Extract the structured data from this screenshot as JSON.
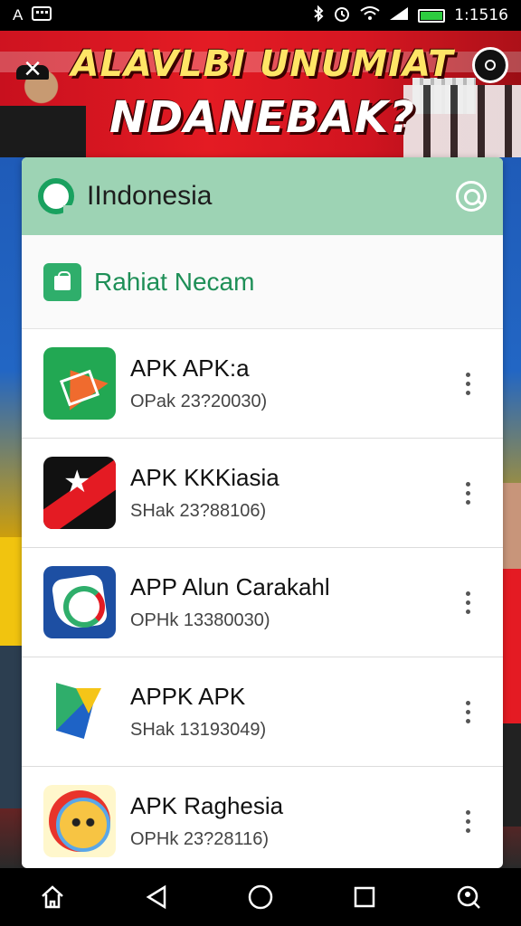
{
  "status_bar": {
    "left_icons": [
      "A",
      "notification-icon"
    ],
    "time": "1:1516"
  },
  "banner": {
    "line1": "ALAVLBI UNUMIAT",
    "line2": "NDANEBAK?",
    "close_label": "×"
  },
  "search": {
    "query": "IIndonesia"
  },
  "section": {
    "title": "Rahiat Necam"
  },
  "apps": [
    {
      "name": "APK APK:a",
      "meta": "OPak 23?20030)",
      "icon": "green-plane-icon"
    },
    {
      "name": "APK KKKiasia",
      "meta": "SHak 23?88106)",
      "icon": "red-star-icon"
    },
    {
      "name": "APP Alun Carakahl",
      "meta": "OPHk 13380030)",
      "icon": "blue-swirl-icon"
    },
    {
      "name": "APPK  APK",
      "meta": "SHak 13193049)",
      "icon": "green-arrow-icon"
    },
    {
      "name": "APK Raghesia",
      "meta": "OPHk 23?28116)",
      "icon": "cat-face-icon"
    }
  ],
  "colors": {
    "accent_green": "#2fae6b",
    "search_bg": "#9dd3b4",
    "banner_red": "#e41b23"
  }
}
